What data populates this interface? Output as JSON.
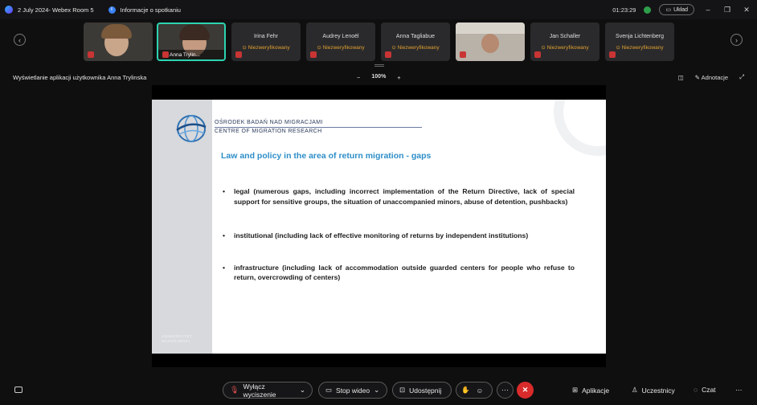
{
  "titlebar": {
    "meeting": "2 July 2024- Webex Room 5",
    "info_label": "Informacje o spotkaniu",
    "timer": "01:23:29",
    "layout_label": "Układ"
  },
  "participants": [
    {
      "name": "",
      "status": "",
      "video": true
    },
    {
      "name": "Anna Trylin...",
      "status": "",
      "video": true,
      "active": true
    },
    {
      "name": "Irina Fehr",
      "status": "Niezweryfikowany"
    },
    {
      "name": "Audrey Lenoël",
      "status": "Niezweryfikowany"
    },
    {
      "name": "Anna Tagliabue",
      "status": "Niezweryfikowany"
    },
    {
      "name": "",
      "status": "",
      "video": true
    },
    {
      "name": "Jan Schaller",
      "status": "Niezweryfikowany"
    },
    {
      "name": "Svenja Lichtenberg",
      "status": "Niezweryfikowany"
    }
  ],
  "share": {
    "title": "Wyświetlanie aplikacji użytkownika Anna Trylinska",
    "zoom": "100%",
    "annotate_label": "Adnotacje"
  },
  "slide": {
    "org_pl": "OŚRODEK BADAŃ NAD MIGRACJAMI",
    "org_en": "CENTRE OF MIGRATION RESEARCH",
    "title": "Law and policy in the area of return migration - gaps",
    "bullets": [
      "legal (numerous gaps, including incorrect implementation of the Return Directive, lack of special support for sensitive groups, the situation of unaccompanied minors, abuse of detention, pushbacks)",
      "institutional (including lack of effective monitoring of returns by independent institutions)",
      "infrastructure (including lack of accommodation outside guarded centers for people who refuse to return, overcrowding of centers)"
    ],
    "university_line1": "UNIWERSYTET",
    "university_line2": "WARSZAWSKI"
  },
  "controls": {
    "mute": "Wyłącz wyciszenie",
    "video": "Stop wideo",
    "share": "Udostępnij",
    "apps": "Aplikacje",
    "participants": "Uczestnicy",
    "chat": "Czat"
  }
}
